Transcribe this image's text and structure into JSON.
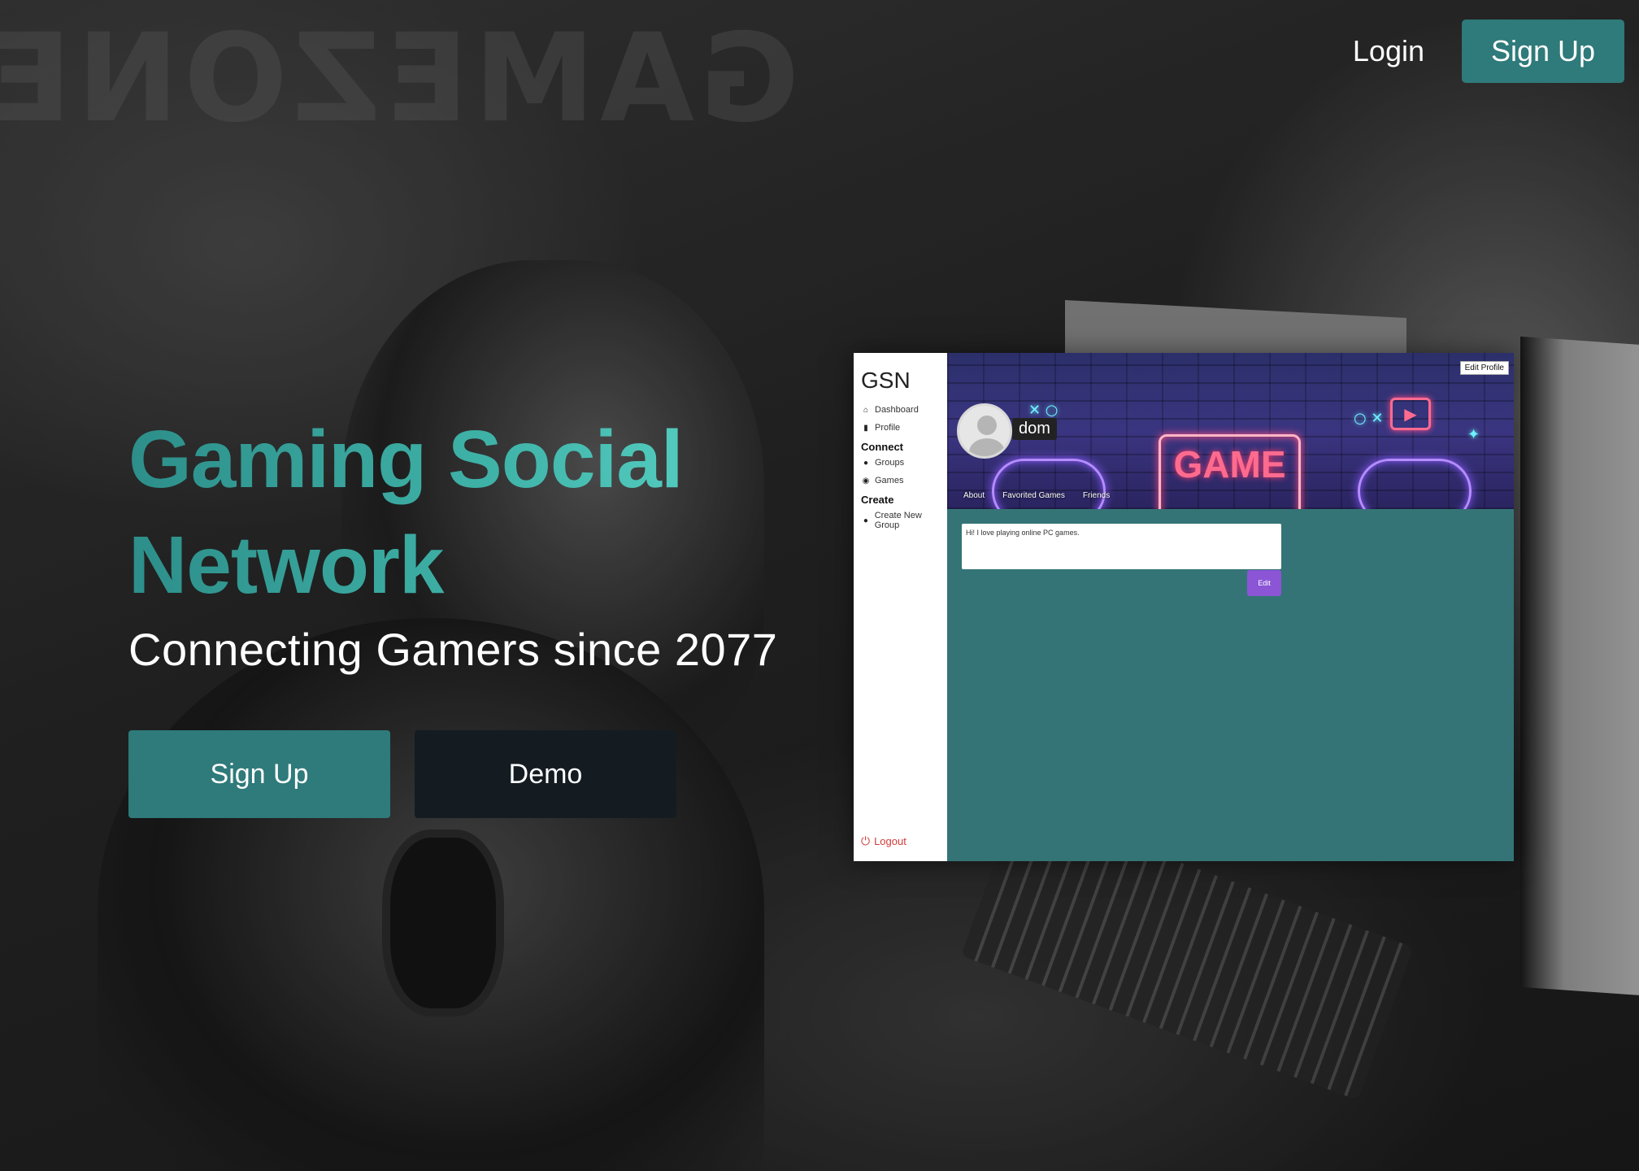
{
  "nav": {
    "login": "Login",
    "signup": "Sign Up"
  },
  "hero": {
    "title_line1": "Gaming Social",
    "title_line2": "Network",
    "subtitle": "Connecting Gamers since 2077",
    "signup_button": "Sign Up",
    "demo_button": "Demo"
  },
  "preview": {
    "brand": "GSN",
    "sidebar": {
      "items": [
        {
          "label": "Dashboard",
          "icon": "home-icon"
        },
        {
          "label": "Profile",
          "icon": "id-card-icon"
        }
      ],
      "connect_heading": "Connect",
      "connect_items": [
        {
          "label": "Groups",
          "icon": "users-icon"
        },
        {
          "label": "Games",
          "icon": "gamepad-icon"
        }
      ],
      "create_heading": "Create",
      "create_items": [
        {
          "label": "Create New Group",
          "icon": "users-icon"
        }
      ],
      "logout": "Logout"
    },
    "edit_profile": "Edit Profile",
    "username": "dom",
    "tabs": [
      "About",
      "Favorited Games",
      "Friends"
    ],
    "bio": "Hi! I love playing online PC games.",
    "edit_button": "Edit",
    "banner_text": "GAME"
  },
  "colors": {
    "accent": "#2f7a7a",
    "dark_button": "#141c22",
    "preview_bg": "#347476",
    "edit_purple": "#8b55d6",
    "logout_red": "#d23b3b"
  }
}
